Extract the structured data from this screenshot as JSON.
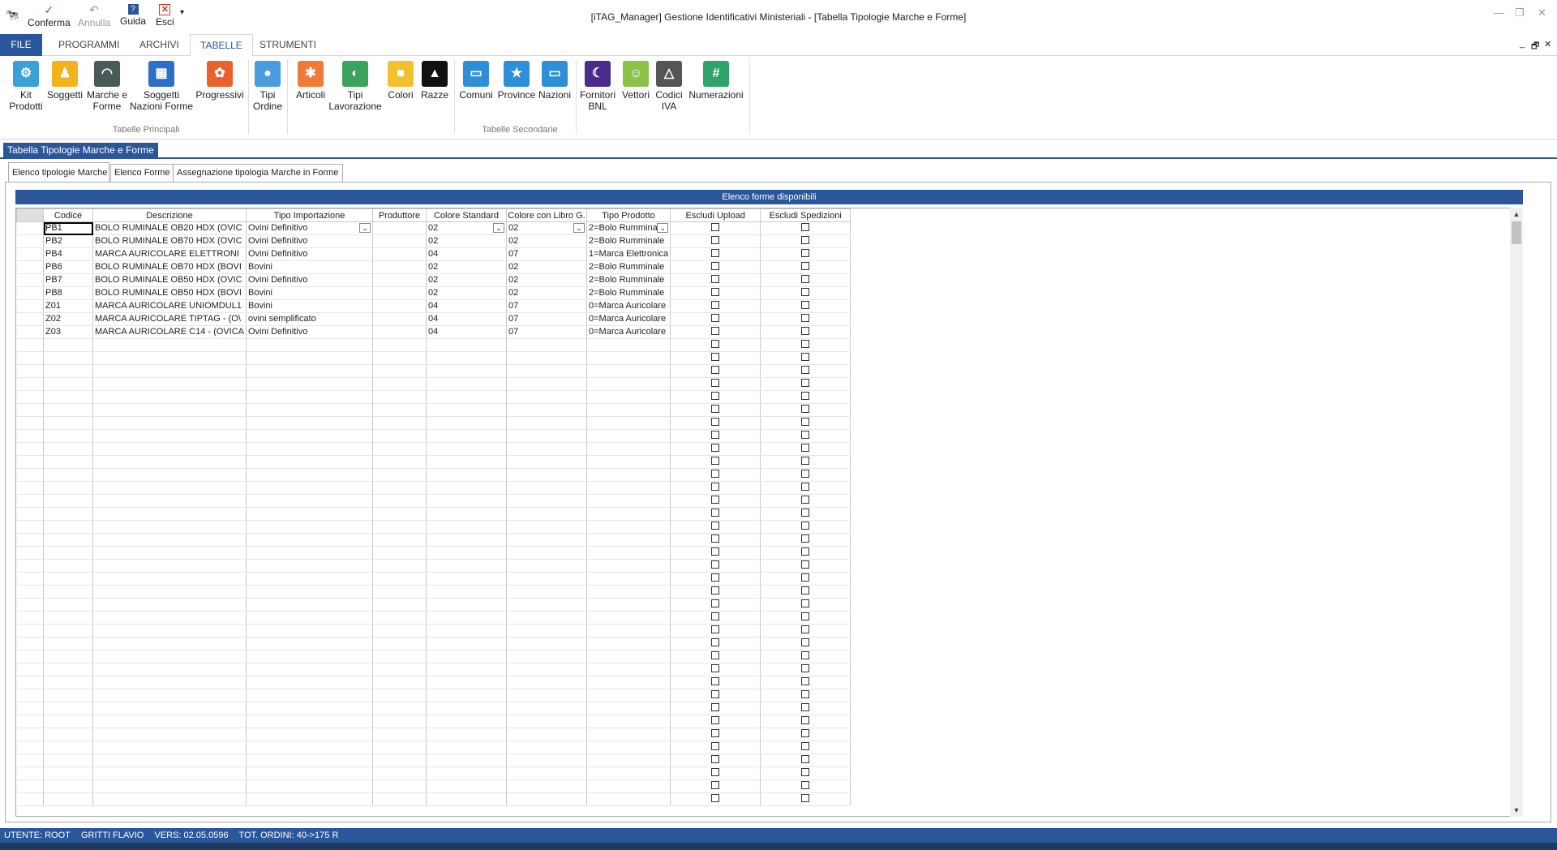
{
  "window": {
    "title": "[iTAG_Manager] Gestione Identificativi Ministeriali - [Tabella Tipologie Marche e Forme]"
  },
  "quick_access": {
    "confirm": "Conferma",
    "cancel": "Annulla",
    "help": "Guida",
    "exit": "Esci"
  },
  "ribbon_tabs": [
    "FILE",
    "PROGRAMMI",
    "ARCHIVI",
    "TABELLE",
    "STRUMENTI"
  ],
  "ribbon": {
    "kit_prodotti": "Kit\nProdotti",
    "soggetti": "Soggetti",
    "marche_forme": "Marche e\nForme",
    "soggetti_nazioni": "Soggetti\nNazioni Forme",
    "progressivi": "Progressivi",
    "tipi_ordine": "Tipi\nOrdine",
    "articoli": "Articoli",
    "tipi_lavorazione": "Tipi\nLavorazione",
    "colori": "Colori",
    "razze": "Razze",
    "comuni": "Comuni",
    "province": "Province",
    "nazioni": "Nazioni",
    "fornitori_bnl": "Fornitori\nBNL",
    "vettori": "Vettori",
    "codici_iva": "Codici\nIVA",
    "numerazioni": "Numerazioni",
    "group_principali": "Tabelle Principali",
    "group_secondarie": "Tabelle Secondarie"
  },
  "document_tab": "Tabella Tipologie Marche e Forme",
  "inner_tabs": [
    "Elenco tipologie Marche",
    "Elenco Forme",
    "Assegnazione tipologia Marche in Forme"
  ],
  "grid": {
    "band_title": "Elenco forme disponibili",
    "columns": [
      "Codice",
      "Descrizione",
      "Tipo Importazione",
      "Produttore",
      "Colore Standard",
      "Colore con Libro G.",
      "Tipo Prodotto",
      "Escludi Upload",
      "Escludi Spedizioni"
    ],
    "rows": [
      {
        "codice": "PB1",
        "descrizione": "BOLO RUMINALE OB20 HDX (OVIC",
        "tipo_importazione": "Ovini Definitivo",
        "produttore": "",
        "colore_standard": "02",
        "colore_libro": "02",
        "tipo_prodotto": "2=Bolo Rummina"
      },
      {
        "codice": "PB2",
        "descrizione": "BOLO RUMINALE OB70 HDX (OVIC",
        "tipo_importazione": "Ovini Definitivo",
        "produttore": "",
        "colore_standard": "02",
        "colore_libro": "02",
        "tipo_prodotto": "2=Bolo Rumminale"
      },
      {
        "codice": "PB4",
        "descrizione": "MARCA AURICOLARE ELETTRONI",
        "tipo_importazione": "Ovini Definitivo",
        "produttore": "",
        "colore_standard": "04",
        "colore_libro": "07",
        "tipo_prodotto": "1=Marca Elettronica"
      },
      {
        "codice": "PB6",
        "descrizione": "BOLO RUMINALE OB70 HDX (BOVI",
        "tipo_importazione": "Bovini",
        "produttore": "",
        "colore_standard": "02",
        "colore_libro": "02",
        "tipo_prodotto": "2=Bolo Rumminale"
      },
      {
        "codice": "PB7",
        "descrizione": "BOLO RUMINALE OB50 HDX (OVIC",
        "tipo_importazione": "Ovini Definitivo",
        "produttore": "",
        "colore_standard": "02",
        "colore_libro": "02",
        "tipo_prodotto": "2=Bolo Rumminale"
      },
      {
        "codice": "PB8",
        "descrizione": "BOLO RUMINALE OB50 HDX (BOVI",
        "tipo_importazione": "Bovini",
        "produttore": "",
        "colore_standard": "02",
        "colore_libro": "02",
        "tipo_prodotto": "2=Bolo Rumminale"
      },
      {
        "codice": "Z01",
        "descrizione": "MARCA AURICOLARE UNIOMDUL1",
        "tipo_importazione": "Bovini",
        "produttore": "",
        "colore_standard": "04",
        "colore_libro": "07",
        "tipo_prodotto": "0=Marca Auricolare"
      },
      {
        "codice": "Z02",
        "descrizione": "MARCA AURICOLARE TIPTAG - (O\\",
        "tipo_importazione": "ovini semplificato",
        "produttore": "",
        "colore_standard": "04",
        "colore_libro": "07",
        "tipo_prodotto": "0=Marca Auricolare"
      },
      {
        "codice": "Z03",
        "descrizione": "MARCA AURICOLARE C14 - (OVICA",
        "tipo_importazione": "Ovini Definitivo",
        "produttore": "",
        "colore_standard": "04",
        "colore_libro": "07",
        "tipo_prodotto": "0=Marca Auricolare"
      }
    ]
  },
  "status": {
    "utente": "UTENTE: ROOT",
    "nome": "GRITTI FLAVIO",
    "versione": "VERS: 02.05.0596",
    "ordini": "TOT. ORDINI: 40->175 R"
  },
  "colors": {
    "accent": "#2b579a"
  }
}
